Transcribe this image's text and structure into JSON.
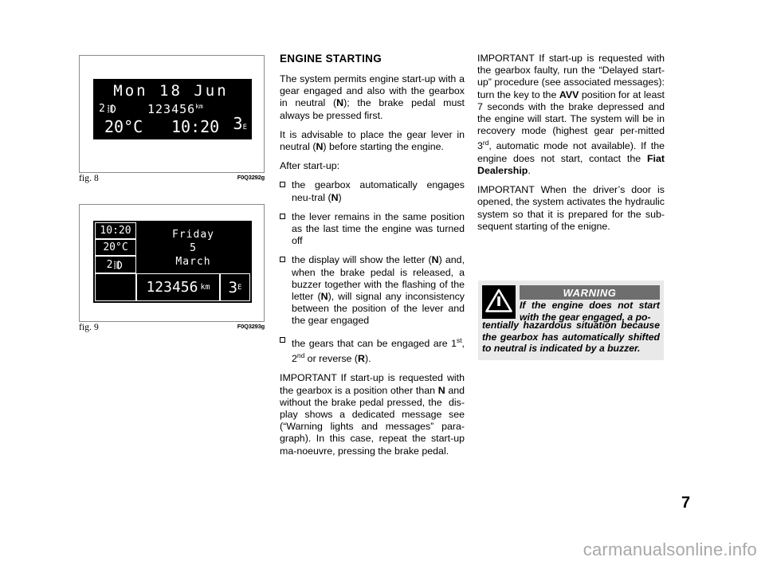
{
  "page": {
    "number": "7",
    "watermark": "carmanualsonline.info"
  },
  "figures": [
    {
      "caption": "fig. 8",
      "code": "F0Q3292g",
      "display": {
        "date": "Mon 18 Jun",
        "gear_left": "2",
        "lamp_icon": "headlamp-icon",
        "odometer": "123456",
        "odometer_unit": "km",
        "temperature": "20°C",
        "time": "10:20",
        "gear": "3",
        "gear_sub": "E"
      }
    },
    {
      "caption": "fig. 9",
      "code": "F0Q3293g",
      "display": {
        "time": "10:20",
        "temperature": "20°C",
        "gear_left": "2",
        "lamp_icon": "headlamp-icon",
        "day": "Friday",
        "day_number": "5",
        "month": "March",
        "odometer": "123456",
        "odometer_unit": "km",
        "gear": "3",
        "gear_sub": "E"
      }
    }
  ],
  "main": {
    "title": "ENGINE STARTING",
    "paragraphs": [
      {
        "id": "p1",
        "html": "The system permits engine start-up with a gear engaged and also with the gearbox in neutral (<span class=\"b\">N</span>); the brake pedal must always be pressed first."
      },
      {
        "id": "p2",
        "html": "It is advisable to place the gear lever in neutral (<span class=\"b\">N</span>) before starting the engine."
      },
      {
        "id": "p3",
        "html": "After start-up:"
      }
    ],
    "bullets": [
      {
        "id": "b1",
        "html": "the gearbox automatically engages neu-tral (<span class=\"b\">N</span>)"
      },
      {
        "id": "b2",
        "html": "the lever remains in the same position as the last time the engine was turned off"
      },
      {
        "id": "b3",
        "html": "the display will show the letter (<span class=\"b\">N</span>) and, when the brake pedal is released, a buzzer together with the flashing of the letter (<span class=\"b\">N</span>), will signal any inconsistency between the position of the lever and the gear engaged"
      },
      {
        "id": "b4",
        "html": "the gears that can be engaged are 1<sup class=\"ord\">st</sup>, 2<sup class=\"ord\">nd</sup> or reverse (<span class=\"b\">R</span>)."
      }
    ],
    "closing": {
      "id": "p4",
      "html": "IMPORTANT If start-up is requested with the gearbox is a position other than <span class=\"b\">N</span> and without the brake pedal pressed, the &nbsp;dis-play shows a dedicated message see (“Warning lights and messages” para-graph). In this case, repeat the start-up ma-noeuvre, pressing the brake pedal."
    }
  },
  "sidebar": {
    "paragraphs": [
      {
        "id": "r1",
        "html": "IMPORTANT If start-up is requested with the gearbox faulty, run the “Delayed start-up” procedure (see associated messages): turn the key to the <span class=\"b\">AVV</span> position for at least 7 seconds with the brake depressed and the engine will start. The system will be in recovery mode (highest gear per-mitted 3<sup class=\"ord\">rd</sup>, automatic mode not available). If the engine does not start, contact the <span class=\"b\">Fiat Dealership</span>."
      },
      {
        "id": "r2",
        "html": "IMPORTANT When the driver’s door is opened, the system activates the hydraulic system so that it is prepared for the sub-sequent starting of the enigne."
      }
    ]
  },
  "warning": {
    "title": "WARNING",
    "icon": "warning-triangle-icon",
    "text_indent": "If the engine does not start with the gear engaged, a po-",
    "text_rest": "tentially hazardous situation because the gearbox has automatically shifted to neutral is indicated by a buzzer.",
    "colors": {
      "background": "#e9e9e9",
      "header_bar": "#6e6e6e",
      "icon_box": "#000000"
    }
  }
}
